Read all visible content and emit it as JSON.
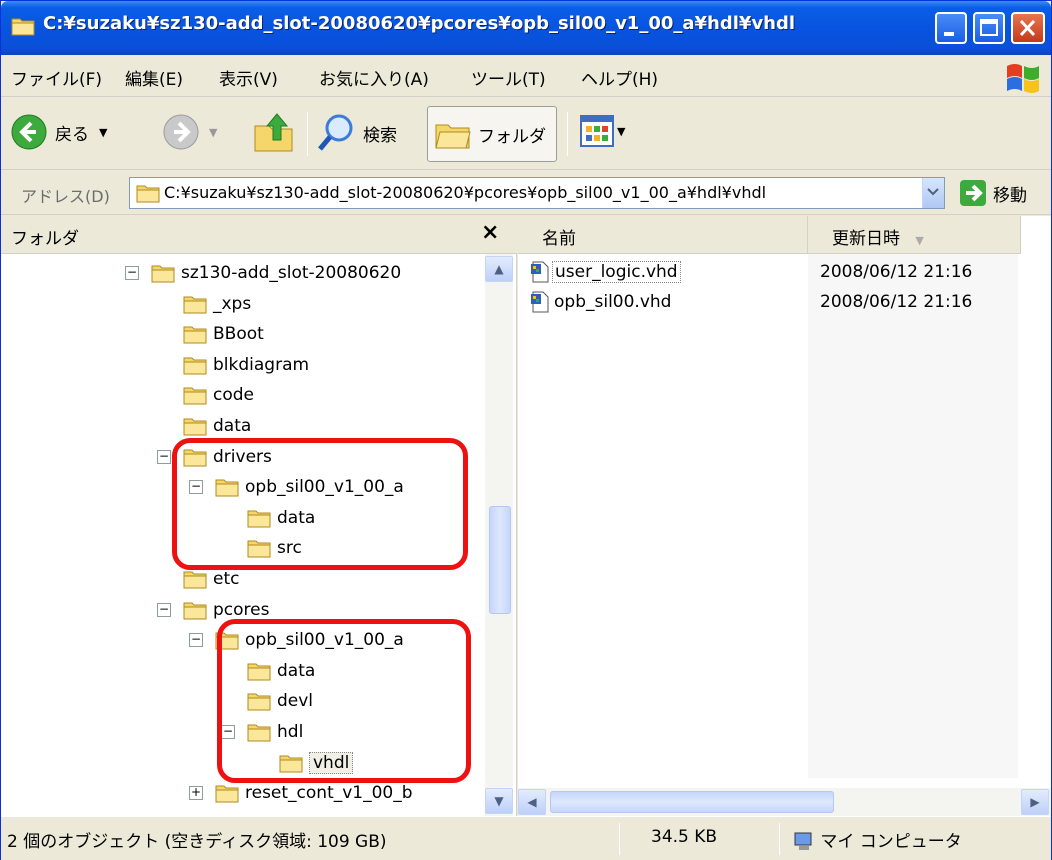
{
  "window": {
    "title": "C:¥suzaku¥sz130-add_slot-20080620¥pcores¥opb_sil00_v1_00_a¥hdl¥vhdl"
  },
  "menu": [
    "ファイル(F)",
    "編集(E)",
    "表示(V)",
    "お気に入り(A)",
    "ツール(T)",
    "ヘルプ(H)"
  ],
  "toolbar": {
    "back_label": "戻る",
    "search_label": "検索",
    "folders_label": "フォルダ"
  },
  "address": {
    "label": "アドレス(D)",
    "value": "C:¥suzaku¥sz130-add_slot-20080620¥pcores¥opb_sil00_v1_00_a¥hdl¥vhdl",
    "go_label": "移動"
  },
  "folders_pane": {
    "title": "フォルダ",
    "close_glyph": "×",
    "tree": [
      {
        "label": "sz130-add_slot-20080620",
        "expander": "-"
      },
      {
        "label": "_xps",
        "expander": ""
      },
      {
        "label": "BBoot",
        "expander": ""
      },
      {
        "label": "blkdiagram",
        "expander": ""
      },
      {
        "label": "code",
        "expander": ""
      },
      {
        "label": "data",
        "expander": ""
      },
      {
        "label": "drivers",
        "expander": "-"
      },
      {
        "label": "opb_sil00_v1_00_a",
        "expander": "-"
      },
      {
        "label": "data",
        "expander": ""
      },
      {
        "label": "src",
        "expander": ""
      },
      {
        "label": "etc",
        "expander": ""
      },
      {
        "label": "pcores",
        "expander": "-"
      },
      {
        "label": "opb_sil00_v1_00_a",
        "expander": "-"
      },
      {
        "label": "data",
        "expander": ""
      },
      {
        "label": "devl",
        "expander": ""
      },
      {
        "label": "hdl",
        "expander": "-"
      },
      {
        "label": "vhdl",
        "expander": "",
        "selected": true
      },
      {
        "label": "reset_cont_v1_00_b",
        "expander": "+"
      }
    ]
  },
  "files_pane": {
    "columns": [
      "名前",
      "更新日時"
    ],
    "files": [
      {
        "name": "user_logic.vhd",
        "modified": "2008/06/12 21:16"
      },
      {
        "name": "opb_sil00.vhd",
        "modified": "2008/06/12 21:16"
      }
    ]
  },
  "status": {
    "objects": "2 個のオブジェクト (空きディスク領域: 109 GB)",
    "size": "34.5 KB",
    "location": "マイ コンピュータ"
  },
  "colors": {
    "title_blue": "#0854e0",
    "highlight_red": "#ee1111",
    "folder_yellow": "#f5d66b"
  }
}
